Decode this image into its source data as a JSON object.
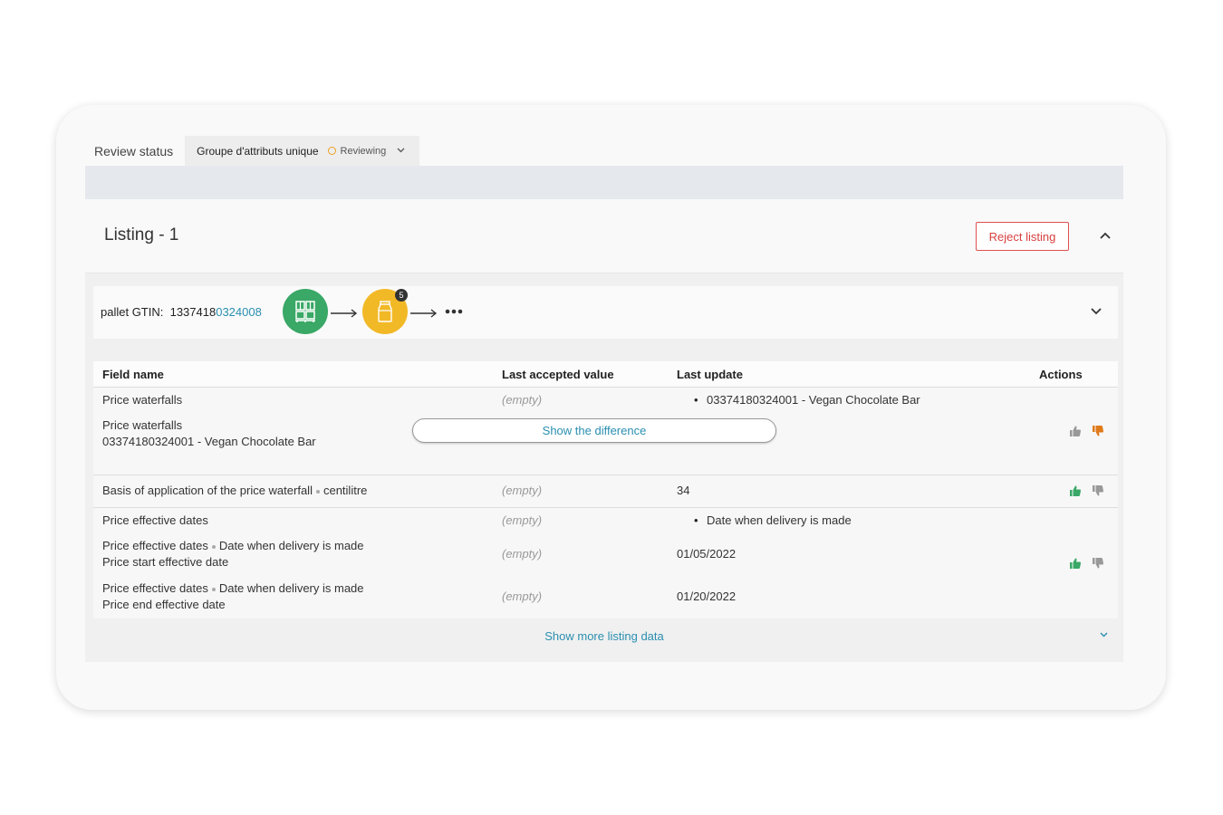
{
  "tabs": {
    "review_status": "Review status",
    "group_name": "Groupe d'attributs unique",
    "group_status": "Reviewing"
  },
  "listing": {
    "title": "Listing - 1",
    "reject_label": "Reject listing"
  },
  "gtin": {
    "label": "pallet GTIN:",
    "prefix": "1337418",
    "highlight": "0324008",
    "badge_count": "5"
  },
  "table": {
    "headers": {
      "field": "Field name",
      "last_accepted": "Last accepted value",
      "last_update": "Last update",
      "actions": "Actions"
    },
    "rows": [
      {
        "field": "Price waterfalls",
        "accepted": "(empty)",
        "update": "03374180324001 - Vegan Chocolate Bar"
      },
      {
        "field_line1": "Price waterfalls",
        "field_line2": "03374180324001 - Vegan Chocolate Bar",
        "diff_label": "Show the difference"
      },
      {
        "field": "Basis of application of the price waterfall",
        "field_suffix": "centilitre",
        "accepted": "(empty)",
        "update": "34"
      },
      {
        "field": "Price effective dates",
        "accepted": "(empty)",
        "update": "Date when delivery is made"
      },
      {
        "field_line1a": "Price effective dates",
        "field_line1b": "Date when delivery is made",
        "field_line2": "Price start effective date",
        "accepted": "(empty)",
        "update": "01/05/2022"
      },
      {
        "field_line1a": "Price effective dates",
        "field_line1b": "Date when delivery is made",
        "field_line2": "Price end effective date",
        "accepted": "(empty)",
        "update": "01/20/2022"
      }
    ]
  },
  "more": {
    "label": "Show more listing data"
  },
  "colors": {
    "accent": "#2a8fb0",
    "reject": "#d84040",
    "approve": "#3aa866",
    "decline": "#e07a1a",
    "node_green": "#3aa866",
    "node_yellow": "#f2b927"
  }
}
